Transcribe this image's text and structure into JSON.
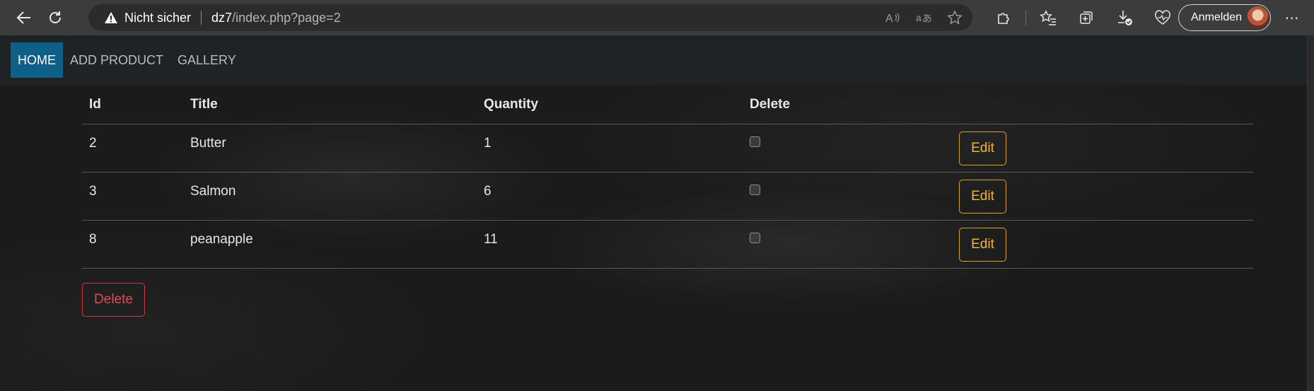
{
  "browser": {
    "security_label": "Nicht sicher",
    "url_host": "dz7",
    "url_path": "/index.php?page=2",
    "signin_label": "Anmelden",
    "more_label": "⋯"
  },
  "nav": {
    "items": [
      {
        "label": "HOME",
        "active": true
      },
      {
        "label": "ADD PRODUCT",
        "active": false
      },
      {
        "label": "GALLERY",
        "active": false
      }
    ]
  },
  "table": {
    "headers": [
      "Id",
      "Title",
      "Quantity",
      "Delete"
    ],
    "rows": [
      {
        "id": "2",
        "title": "Butter",
        "quantity": "1",
        "edit_label": "Edit"
      },
      {
        "id": "3",
        "title": "Salmon",
        "quantity": "6",
        "edit_label": "Edit"
      },
      {
        "id": "8",
        "title": "peanapple",
        "quantity": "11",
        "edit_label": "Edit"
      }
    ]
  },
  "actions": {
    "delete_label": "Delete"
  },
  "colors": {
    "active_nav": "#0f6088",
    "edit_accent": "#f0b631",
    "delete_accent": "#e04a52"
  }
}
